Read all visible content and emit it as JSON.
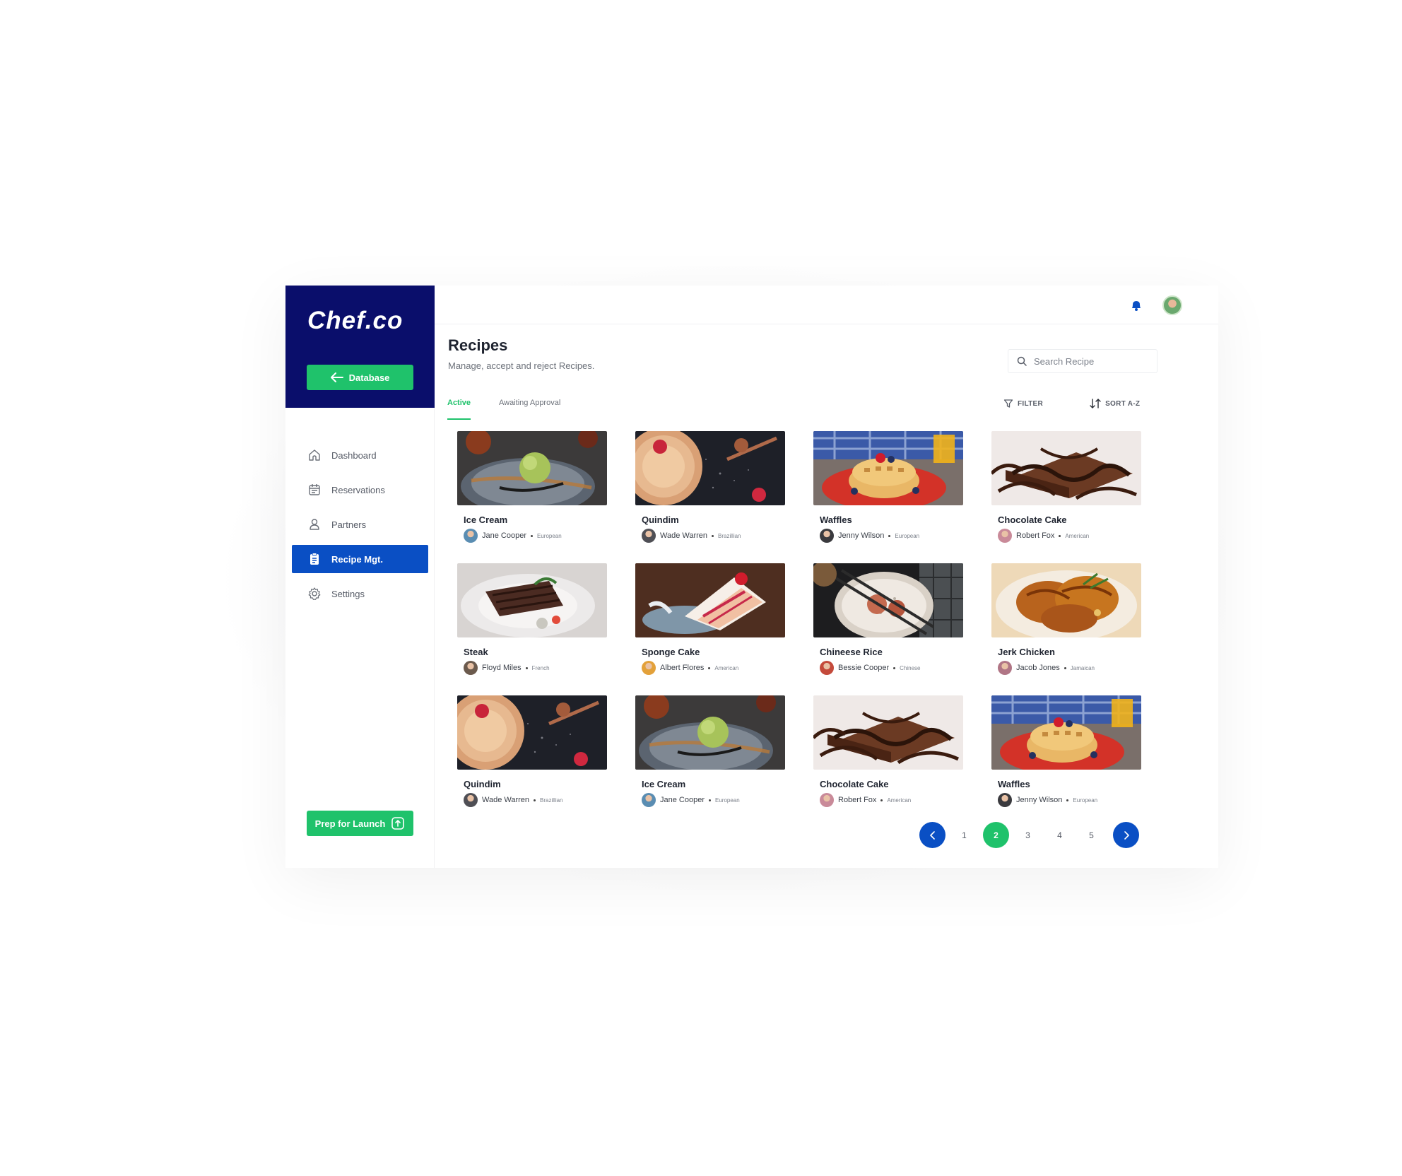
{
  "brand": {
    "logo": "Chef.co",
    "database_label": "Database"
  },
  "nav": [
    {
      "label": "Dashboard",
      "icon": "home-icon",
      "active": false
    },
    {
      "label": "Reservations",
      "icon": "calendar-icon",
      "active": false
    },
    {
      "label": "Partners",
      "icon": "user-icon",
      "active": false
    },
    {
      "label": "Recipe Mgt.",
      "icon": "clipboard-icon",
      "active": true
    },
    {
      "label": "Settings",
      "icon": "gear-icon",
      "active": false
    }
  ],
  "prep_label": "Prep for Launch",
  "page": {
    "title": "Recipes",
    "subtitle": "Manage, accept and reject Recipes."
  },
  "search": {
    "placeholder": "Search Recipe"
  },
  "tabs": [
    {
      "label": "Active",
      "active": true
    },
    {
      "label": "Awaiting Approval",
      "active": false
    }
  ],
  "tools": {
    "filter": "FILTER",
    "sort": "SORT A-Z"
  },
  "colors": {
    "navy": "#0a0e6b",
    "green": "#1fc26b",
    "blue": "#0a4fc4"
  },
  "recipes": [
    {
      "title": "Ice Cream",
      "author": "Jane Cooper",
      "cuisine": "European",
      "image": "ice-cream"
    },
    {
      "title": "Quindim",
      "author": "Wade Warren",
      "cuisine": "Brazillian",
      "image": "tart"
    },
    {
      "title": "Waffles",
      "author": "Jenny Wilson",
      "cuisine": "European",
      "image": "waffles"
    },
    {
      "title": "Chocolate Cake",
      "author": "Robert Fox",
      "cuisine": "American",
      "image": "choc-cake"
    },
    {
      "title": "Steak",
      "author": "Floyd Miles",
      "cuisine": "French",
      "image": "steak"
    },
    {
      "title": "Sponge Cake",
      "author": "Albert Flores",
      "cuisine": "American",
      "image": "sponge"
    },
    {
      "title": "Chineese Rice",
      "author": "Bessie Cooper",
      "cuisine": "Chinese",
      "image": "rice"
    },
    {
      "title": "Jerk Chicken",
      "author": "Jacob Jones",
      "cuisine": "Jamaican",
      "image": "chicken"
    },
    {
      "title": "Quindim",
      "author": "Wade Warren",
      "cuisine": "Brazillian",
      "image": "tart"
    },
    {
      "title": "Ice Cream",
      "author": "Jane Cooper",
      "cuisine": "European",
      "image": "ice-cream"
    },
    {
      "title": "Chocolate Cake",
      "author": "Robert Fox",
      "cuisine": "American",
      "image": "choc-cake"
    },
    {
      "title": "Waffles",
      "author": "Jenny Wilson",
      "cuisine": "European",
      "image": "waffles"
    }
  ],
  "pagination": {
    "pages": [
      "1",
      "2",
      "3",
      "4",
      "5"
    ],
    "current": "2"
  }
}
